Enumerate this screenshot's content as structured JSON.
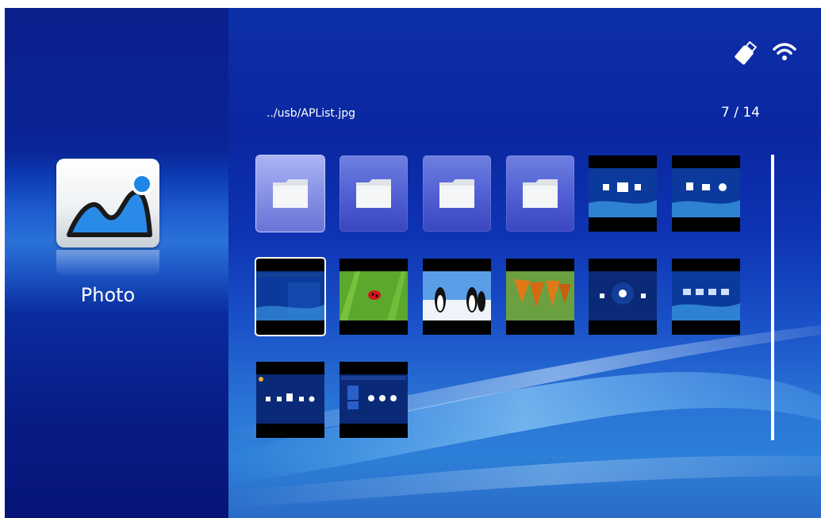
{
  "app": {
    "title": "Photo",
    "icon": "photo-landscape-icon"
  },
  "status_bar": {
    "icons": [
      "usb-drive-icon",
      "wifi-icon"
    ]
  },
  "browser": {
    "path": "../usb/APList.jpg",
    "position": "7 / 14",
    "current_index": 7,
    "total": 14,
    "items": [
      {
        "type": "folder",
        "icon": "folder-icon"
      },
      {
        "type": "folder",
        "icon": "folder-icon"
      },
      {
        "type": "folder",
        "icon": "folder-icon"
      },
      {
        "type": "folder",
        "icon": "folder-icon"
      },
      {
        "type": "image",
        "subject": "menu screenshot"
      },
      {
        "type": "image",
        "subject": "menu screenshot"
      },
      {
        "type": "image",
        "subject": "wifi list screenshot"
      },
      {
        "type": "image",
        "subject": "ladybug on grass"
      },
      {
        "type": "image",
        "subject": "penguins"
      },
      {
        "type": "image",
        "subject": "butterflies"
      },
      {
        "type": "image",
        "subject": "projector screenshot"
      },
      {
        "type": "image",
        "subject": "setting screenshot"
      },
      {
        "type": "image",
        "subject": "setting screenshot"
      },
      {
        "type": "image",
        "subject": "setting screenshot"
      }
    ]
  },
  "colors": {
    "background": "#0c2fa8",
    "accent": "#5161d4",
    "text": "#ffffff"
  }
}
